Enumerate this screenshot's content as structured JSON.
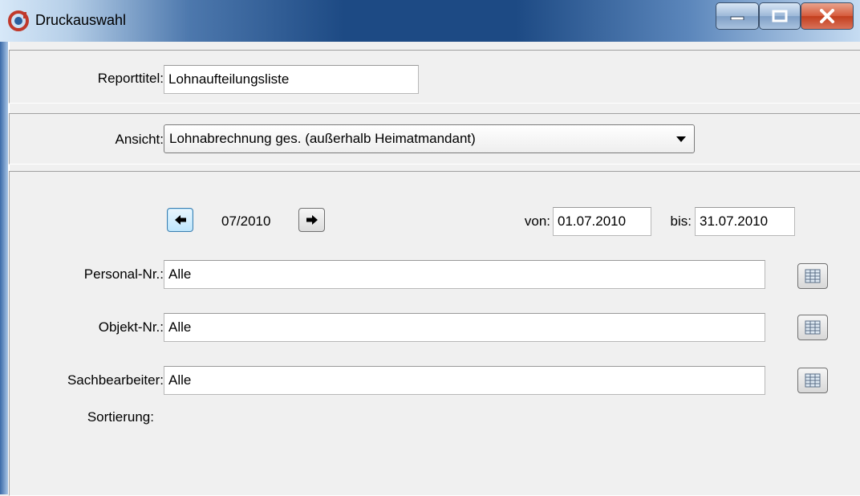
{
  "window": {
    "title": "Druckauswahl",
    "icon": "app-logo-icon",
    "controls": [
      "minimize-icon",
      "maximize-icon",
      "close-icon"
    ]
  },
  "report": {
    "label": "Reporttitel:",
    "value": "Lohnaufteilungsliste"
  },
  "view": {
    "label": "Ansicht:",
    "selected": "Lohnabrechnung ges. (außerhalb Heimatmandant)"
  },
  "period": {
    "value": "07/2010",
    "prev_icon": "arrow-left-icon",
    "next_icon": "arrow-right-icon",
    "from_label": "von:",
    "from_value": "01.07.2010",
    "to_label": "bis:",
    "to_value": "31.07.2010"
  },
  "filters": {
    "personal": {
      "label": "Personal-Nr.:",
      "value": "Alle"
    },
    "objekt": {
      "label": "Objekt-Nr.:",
      "value": "Alle"
    },
    "sachbearbeiter": {
      "label": "Sachbearbeiter:",
      "value": "Alle"
    },
    "lookup_icon": "table-lookup-icon"
  },
  "sorting": {
    "label": "Sortierung:"
  }
}
